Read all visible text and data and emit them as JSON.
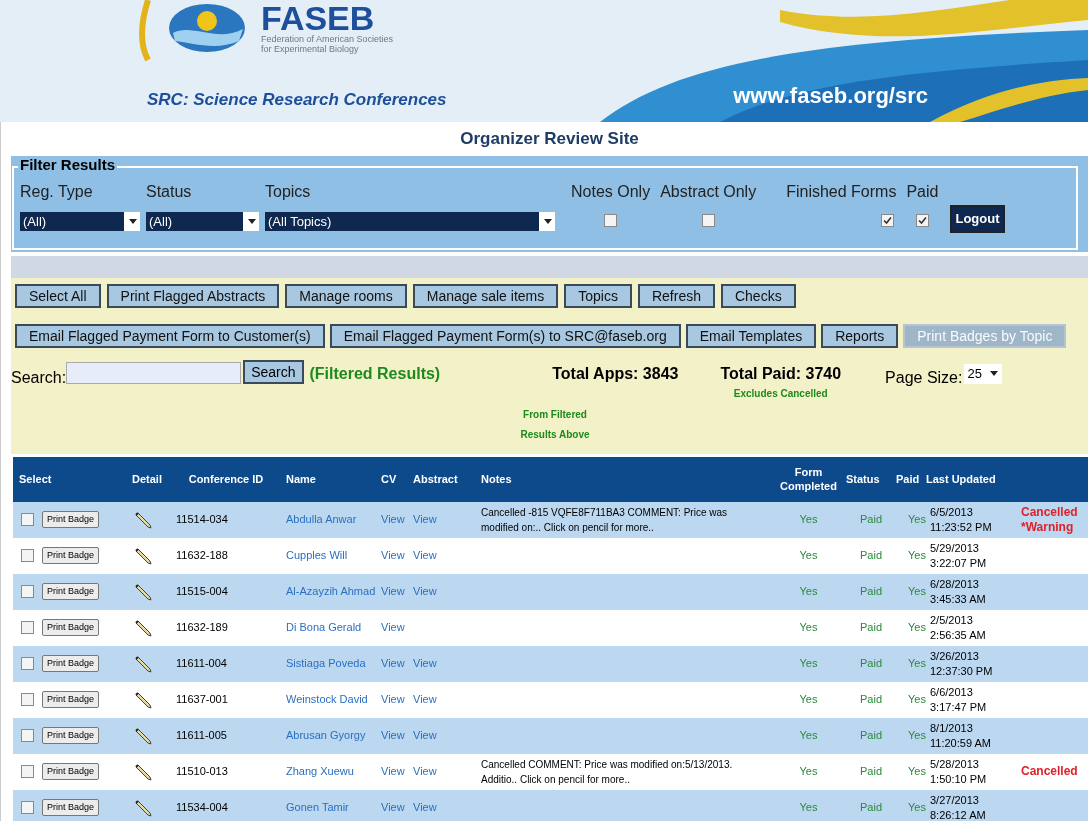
{
  "banner": {
    "logo_text": "FASEB",
    "org_line1": "Federation of American Societies",
    "org_line2": "for Experimental Biology",
    "tagline": "SRC: Science Research Conferences",
    "url": "www.faseb.org/src"
  },
  "site_title": "Organizer Review Site",
  "filter": {
    "legend": "Filter Results",
    "selects": [
      {
        "label": "Reg. Type",
        "value": "(All)"
      },
      {
        "label": "Status",
        "value": "(All)"
      },
      {
        "label": "Topics",
        "value": "(All Topics)"
      }
    ],
    "checks": [
      {
        "label": "Notes Only",
        "checked": false
      },
      {
        "label": "Abstract Only",
        "checked": false
      },
      {
        "label": "Finished Forms",
        "checked": true
      },
      {
        "label": "Paid",
        "checked": true
      }
    ],
    "logout": "Logout"
  },
  "toolbar_row1": [
    {
      "label": "Select All",
      "disabled": false
    },
    {
      "label": "Print Flagged Abstracts",
      "disabled": false
    },
    {
      "label": "Manage rooms",
      "disabled": false
    },
    {
      "label": "Manage sale items",
      "disabled": false
    },
    {
      "label": "Topics",
      "disabled": false
    },
    {
      "label": "Refresh",
      "disabled": false
    },
    {
      "label": "Checks",
      "disabled": false
    }
  ],
  "toolbar_row2": [
    {
      "label": "Email Flagged Payment Form to Customer(s)",
      "disabled": false
    },
    {
      "label": "Email Flagged Payment Form(s) to SRC@faseb.org",
      "disabled": false
    },
    {
      "label": "Email Templates",
      "disabled": false
    },
    {
      "label": "Reports",
      "disabled": false
    },
    {
      "label": "Print Badges by Topic",
      "disabled": true
    }
  ],
  "search": {
    "label": "Search:",
    "button": "Search",
    "filtered": "(Filtered Results)",
    "from_filtered_1": "From Filtered",
    "from_filtered_2": "Results Above"
  },
  "totals": {
    "apps": "Total Apps: 3843",
    "paid": "Total Paid: 3740",
    "paid_note": "Excludes Cancelled"
  },
  "page_size": {
    "label": "Page Size:",
    "value": "25"
  },
  "table": {
    "columns": [
      "Select",
      "Detail",
      "Conference ID",
      "Name",
      "CV",
      "Abstract",
      "Notes",
      "Form Completed",
      "Status",
      "Paid",
      "Last Updated"
    ],
    "rows": [
      {
        "checked": false,
        "badge": "Print Badge",
        "conference_id": "11514-034",
        "name": "Abdulla Anwar",
        "cv": "View",
        "abstract": "View",
        "notes": "Cancelled -815 VQFE8F711BA3 COMMENT: Price was modified on:.. Click on pencil for more..",
        "form_completed": "Yes",
        "status": "Paid",
        "paid": "Yes",
        "date": "6/5/2013",
        "time": "11:23:52 PM",
        "flags": [
          "Cancelled",
          "*Warning"
        ]
      },
      {
        "checked": false,
        "badge": "Print Badge",
        "conference_id": "11632-188",
        "name": "Cupples Will",
        "cv": "View",
        "abstract": "View",
        "form_completed": "Yes",
        "status": "Paid",
        "paid": "Yes",
        "date": "5/29/2013",
        "time": "3:22:07 PM",
        "flags": []
      },
      {
        "checked": false,
        "badge": "Print Badge",
        "conference_id": "11515-004",
        "name": "Al-Azayzih Ahmad",
        "cv": "View",
        "abstract": "View",
        "form_completed": "Yes",
        "status": "Paid",
        "paid": "Yes",
        "date": "6/28/2013",
        "time": "3:45:33 AM",
        "flags": []
      },
      {
        "checked": false,
        "badge": "Print Badge",
        "conference_id": "11632-189",
        "name": "Di Bona Gerald",
        "cv": "View",
        "form_completed": "Yes",
        "status": "Paid",
        "paid": "Yes",
        "date": "2/5/2013",
        "time": "2:56:35 AM",
        "flags": []
      },
      {
        "checked": false,
        "badge": "Print Badge",
        "conference_id": "11611-004",
        "name": "Sistiaga Poveda",
        "cv": "View",
        "abstract": "View",
        "form_completed": "Yes",
        "status": "Paid",
        "paid": "Yes",
        "date": "3/26/2013",
        "time": "12:37:30 PM",
        "flags": []
      },
      {
        "checked": false,
        "badge": "Print Badge",
        "conference_id": "11637-001",
        "name": "Weinstock David",
        "cv": "View",
        "abstract": "View",
        "form_completed": "Yes",
        "status": "Paid",
        "paid": "Yes",
        "date": "6/6/2013",
        "time": "3:17:47 PM",
        "flags": []
      },
      {
        "checked": false,
        "badge": "Print Badge",
        "conference_id": "11611-005",
        "name": "Abrusan Gyorgy",
        "cv": "View",
        "abstract": "View",
        "form_completed": "Yes",
        "status": "Paid",
        "paid": "Yes",
        "date": "8/1/2013",
        "time": "11:20:59 AM",
        "flags": []
      },
      {
        "checked": false,
        "badge": "Print Badge",
        "conference_id": "11510-013",
        "name": "Zhang Xuewu",
        "cv": "View",
        "abstract": "View",
        "notes": "Cancelled COMMENT: Price was modified on:5/13/2013. Additio.. Click on pencil for more..",
        "form_completed": "Yes",
        "status": "Paid",
        "paid": "Yes",
        "date": "5/28/2013",
        "time": "1:50:10 PM",
        "flags": [
          "Cancelled"
        ]
      },
      {
        "checked": false,
        "badge": "Print Badge",
        "conference_id": "11534-004",
        "name": "Gonen Tamir",
        "cv": "View",
        "abstract": "View",
        "form_completed": "Yes",
        "status": "Paid",
        "paid": "Yes",
        "date": "3/27/2013",
        "time": "8:26:12 AM",
        "flags": []
      }
    ]
  }
}
